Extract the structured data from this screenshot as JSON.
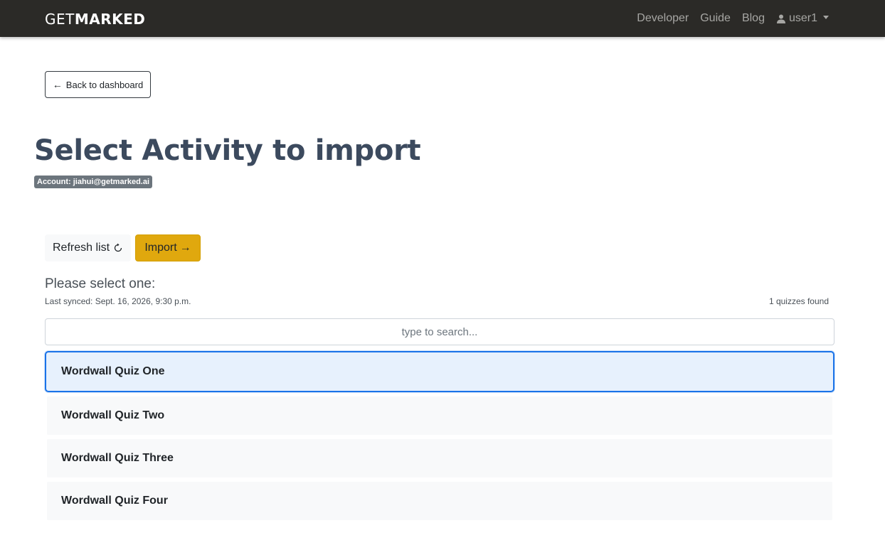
{
  "navbar": {
    "brand_light": "GET",
    "brand_bold": "MARKED",
    "links": [
      "Developer",
      "Guide",
      "Blog"
    ],
    "user": "user1"
  },
  "back_button": {
    "arrow": "←",
    "label": "Back to dashboard"
  },
  "page_title": "Select Activity to import",
  "account_badge": "Account: jiahui@getmarked.ai",
  "toolbar": {
    "refresh_label": "Refresh list",
    "import_label": "Import",
    "import_arrow": "→"
  },
  "select_label": "Please select one:",
  "last_synced": "Last synced: Sept. 16, 2026, 9:30 p.m.",
  "quiz_count": "1 quizzes found",
  "search": {
    "placeholder": "type to search...",
    "value": ""
  },
  "quizzes": [
    {
      "title": "Wordwall Quiz One",
      "selected": true
    },
    {
      "title": "Wordwall Quiz Two",
      "selected": false
    },
    {
      "title": "Wordwall Quiz Three",
      "selected": false
    },
    {
      "title": "Wordwall Quiz Four",
      "selected": false
    }
  ],
  "colors": {
    "navbar_bg": "#2b2a27",
    "title": "#3c4a5e",
    "badge_bg": "#6c757d",
    "import_bg": "#e0a80e",
    "selected_border": "#1a73e8",
    "selected_bg": "#e7f1fd"
  },
  "icons": {
    "user": "user-icon",
    "refresh": "refresh-icon",
    "caret": "chevron-down-icon"
  }
}
